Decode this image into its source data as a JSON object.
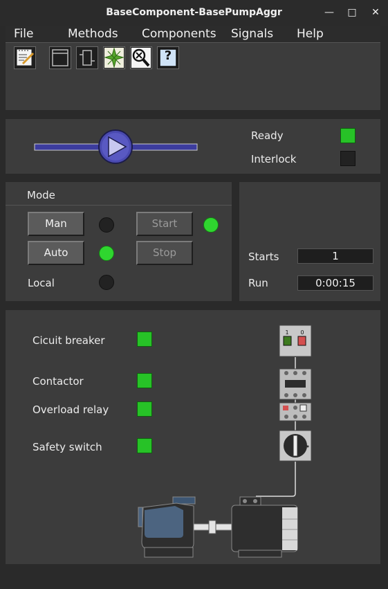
{
  "window": {
    "title": "BaseComponent-BasePumpAggr",
    "minimize": "—",
    "maximize": "□",
    "close": "✕"
  },
  "menu": [
    "File",
    "Methods",
    "Components",
    "Signals",
    "Help"
  ],
  "toolbar": [
    {
      "icon": "notepad-icon"
    },
    {
      "icon": "window-icon"
    },
    {
      "icon": "component-icon"
    },
    {
      "icon": "crossover-star-icon"
    },
    {
      "icon": "magnifier-x-icon"
    },
    {
      "icon": "help-icon",
      "glyph": "?"
    }
  ],
  "status": {
    "ready_label": "Ready",
    "ready_on": true,
    "interlock_label": "Interlock",
    "interlock_on": false,
    "colors": {
      "on": "#27c227",
      "off": "#222222"
    }
  },
  "mode": {
    "title": "Mode",
    "man_button": "Man",
    "auto_button": "Auto",
    "local_label": "Local",
    "start_button": "Start",
    "stop_button": "Stop",
    "man_active": false,
    "auto_active": true,
    "local_active": false,
    "running": true
  },
  "counters": {
    "starts_label": "Starts",
    "starts_value": "1",
    "run_label": "Run",
    "run_value": "0:00:15"
  },
  "signals": [
    {
      "label": "Cicuit breaker",
      "on": true
    },
    {
      "label": "Contactor",
      "on": true
    },
    {
      "label": "Overload relay",
      "on": true
    },
    {
      "label": "Safety switch",
      "on": true
    }
  ],
  "diagram": {
    "breaker_on": "1",
    "breaker_off": "0"
  }
}
